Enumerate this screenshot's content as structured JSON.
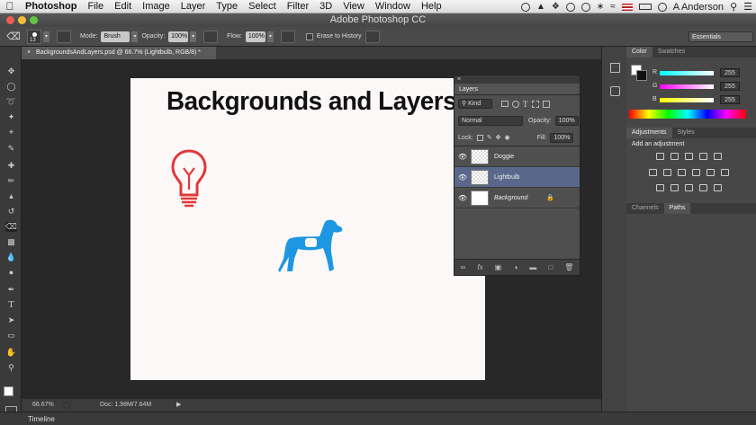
{
  "menubar": {
    "app": "Photoshop",
    "items": [
      "File",
      "Edit",
      "Image",
      "Layer",
      "Type",
      "Select",
      "Filter",
      "3D",
      "View",
      "Window",
      "Help"
    ],
    "user": "A Anderson"
  },
  "window": {
    "title": "Adobe Photoshop CC"
  },
  "options": {
    "mode_label": "Mode:",
    "mode_value": "Brush",
    "opacity_label": "Opacity:",
    "opacity_value": "100%",
    "flow_label": "Flow:",
    "flow_value": "100%",
    "erase_history": "Erase to History",
    "brush_size": "13",
    "workspace": "Essentials"
  },
  "document": {
    "tab": "BackgroundsAndLayers.psd @ 66.7% (Lightbulb, RGB/8) *",
    "canvas_title": "Backgrounds and Layers",
    "zoom": "66.67%",
    "doc_size": "Doc: 1.98M/7.64M"
  },
  "layers_panel": {
    "title": "Layers",
    "kind": "Kind",
    "blend_mode": "Normal",
    "opacity_label": "Opacity:",
    "opacity_value": "100%",
    "lock_label": "Lock:",
    "fill_label": "Fill:",
    "fill_value": "100%",
    "layers": [
      {
        "name": "Doggie",
        "selected": false
      },
      {
        "name": "Lightbulb",
        "selected": true
      },
      {
        "name": "Background",
        "selected": false
      }
    ]
  },
  "color_panel": {
    "tabs": [
      "Color",
      "Swatches"
    ],
    "channels": [
      {
        "label": "R",
        "value": "255"
      },
      {
        "label": "G",
        "value": "255"
      },
      {
        "label": "B",
        "value": "255"
      }
    ]
  },
  "adjustments_panel": {
    "tabs": [
      "Adjustments",
      "Styles"
    ],
    "hint": "Add an adjustment"
  },
  "channels_panel": {
    "tabs": [
      "Channels",
      "Paths"
    ]
  },
  "timeline": {
    "label": "Timeline"
  },
  "colors": {
    "lightbulb": "#e2373a",
    "dog": "#1e97e3",
    "selected_layer": "#59678a"
  }
}
